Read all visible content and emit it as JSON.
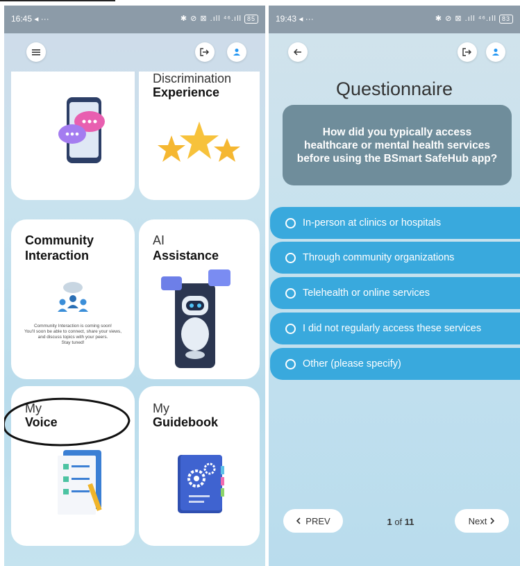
{
  "left": {
    "status": {
      "time": "16:45",
      "extra": "◂ ···",
      "icons": "✱ ⊘ ⊠ .ıll ⁴⁶.ıll",
      "battery": "85"
    },
    "cards": {
      "discrimination": {
        "line1": "Discrimination",
        "line2": "Experience"
      },
      "community": {
        "line1": "Community",
        "line2": "Interaction",
        "note": "Community Interaction is coming soon!\nYou'll soon be able to connect, share your views,\nand discuss topics with your peers.\nStay tuned!"
      },
      "ai": {
        "line1": "AI",
        "line2": "Assistance"
      },
      "voice": {
        "line1": "My",
        "line2": "Voice"
      },
      "guidebook": {
        "line1": "My",
        "line2": "Guidebook"
      }
    }
  },
  "right": {
    "status": {
      "time": "19:43",
      "extra": "◂ ···",
      "icons": "✱ ⊘ ⊠ .ıll ⁴⁶.ıll",
      "battery": "83"
    },
    "title": "Questionnaire",
    "question": "How did you typically access healthcare or mental health services before using the BSmart SafeHub app?",
    "options": [
      "In-person at clinics or hospitals",
      "Through community organizations",
      "Telehealth or online services",
      "I did not regularly access these services",
      "Other (please specify)"
    ],
    "prev_label": "PREV",
    "next_label": "Next",
    "page_current": "1",
    "page_of": "of",
    "page_total": "11"
  },
  "colors": {
    "option_blue": "#39a9dd",
    "question_box": "#6f8d9b",
    "accent_blue": "#2196f3"
  }
}
